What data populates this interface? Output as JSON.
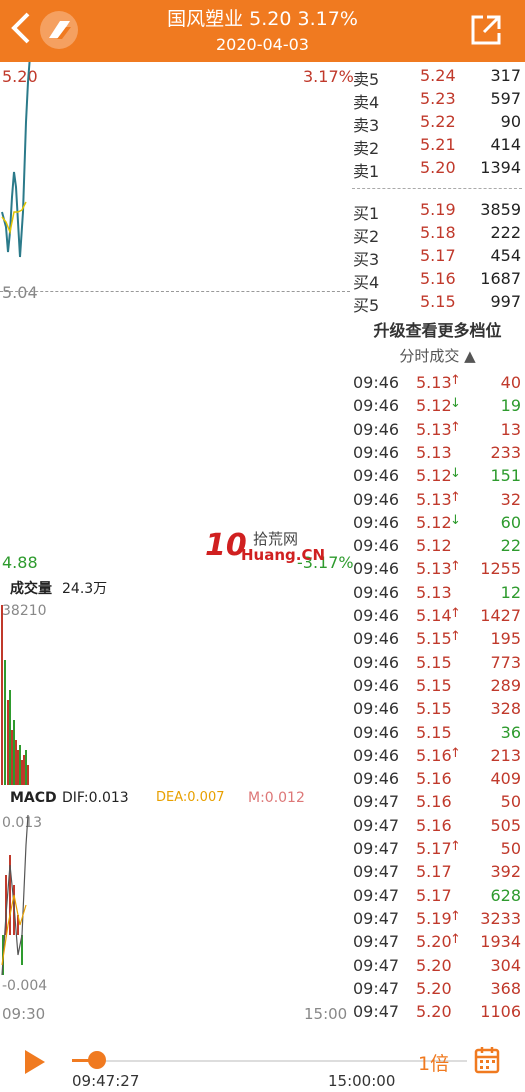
{
  "header": {
    "title": "国风塑业  5.20  3.17%",
    "date": "2020-04-03"
  },
  "price_chart": {
    "high_price": "5.20",
    "high_pct": "3.17%",
    "mid_price": "5.04",
    "low_price": "4.88",
    "low_pct": "-3.17%"
  },
  "volume": {
    "label": "成交量",
    "value": "24.3万",
    "max": "38210"
  },
  "macd": {
    "label": "MACD",
    "dif": "DIF:0.013",
    "dea": "DEA:0.007",
    "m": "M:0.012",
    "top": "0.013",
    "bottom": "-0.004"
  },
  "time_axis": {
    "start": "09:30",
    "end": "15:00"
  },
  "order_book": {
    "asks": [
      {
        "label": "卖5",
        "price": "5.24",
        "vol": "317"
      },
      {
        "label": "卖4",
        "price": "5.23",
        "vol": "597"
      },
      {
        "label": "卖3",
        "price": "5.22",
        "vol": "90"
      },
      {
        "label": "卖2",
        "price": "5.21",
        "vol": "414"
      },
      {
        "label": "卖1",
        "price": "5.20",
        "vol": "1394"
      }
    ],
    "bids": [
      {
        "label": "买1",
        "price": "5.19",
        "vol": "3859"
      },
      {
        "label": "买2",
        "price": "5.18",
        "vol": "222"
      },
      {
        "label": "买3",
        "price": "5.17",
        "vol": "454"
      },
      {
        "label": "买4",
        "price": "5.16",
        "vol": "1687"
      },
      {
        "label": "买5",
        "price": "5.15",
        "vol": "997"
      }
    ]
  },
  "upgrade_label": "升级查看更多档位",
  "ticks_header": "分时成交 ▲",
  "ticks": [
    {
      "time": "09:46",
      "price": "5.13",
      "arrow": "↑",
      "vol": "40",
      "color": "#c0392b",
      "vcolor": "#c0392b"
    },
    {
      "time": "09:46",
      "price": "5.12",
      "arrow": "↓",
      "vol": "19",
      "color": "#c0392b",
      "vcolor": "#2e9b2e"
    },
    {
      "time": "09:46",
      "price": "5.13",
      "arrow": "↑",
      "vol": "13",
      "color": "#c0392b",
      "vcolor": "#c0392b"
    },
    {
      "time": "09:46",
      "price": "5.13",
      "arrow": "",
      "vol": "233",
      "color": "#c0392b",
      "vcolor": "#c0392b"
    },
    {
      "time": "09:46",
      "price": "5.12",
      "arrow": "↓",
      "vol": "151",
      "color": "#c0392b",
      "vcolor": "#2e9b2e"
    },
    {
      "time": "09:46",
      "price": "5.13",
      "arrow": "↑",
      "vol": "32",
      "color": "#c0392b",
      "vcolor": "#c0392b"
    },
    {
      "time": "09:46",
      "price": "5.12",
      "arrow": "↓",
      "vol": "60",
      "color": "#c0392b",
      "vcolor": "#2e9b2e"
    },
    {
      "time": "09:46",
      "price": "5.12",
      "arrow": "",
      "vol": "22",
      "color": "#c0392b",
      "vcolor": "#2e9b2e"
    },
    {
      "time": "09:46",
      "price": "5.13",
      "arrow": "↑",
      "vol": "1255",
      "color": "#c0392b",
      "vcolor": "#c0392b"
    },
    {
      "time": "09:46",
      "price": "5.13",
      "arrow": "",
      "vol": "12",
      "color": "#c0392b",
      "vcolor": "#2e9b2e"
    },
    {
      "time": "09:46",
      "price": "5.14",
      "arrow": "↑",
      "vol": "1427",
      "color": "#c0392b",
      "vcolor": "#c0392b"
    },
    {
      "time": "09:46",
      "price": "5.15",
      "arrow": "↑",
      "vol": "195",
      "color": "#c0392b",
      "vcolor": "#c0392b"
    },
    {
      "time": "09:46",
      "price": "5.15",
      "arrow": "",
      "vol": "773",
      "color": "#c0392b",
      "vcolor": "#c0392b"
    },
    {
      "time": "09:46",
      "price": "5.15",
      "arrow": "",
      "vol": "289",
      "color": "#c0392b",
      "vcolor": "#c0392b"
    },
    {
      "time": "09:46",
      "price": "5.15",
      "arrow": "",
      "vol": "328",
      "color": "#c0392b",
      "vcolor": "#c0392b"
    },
    {
      "time": "09:46",
      "price": "5.15",
      "arrow": "",
      "vol": "36",
      "color": "#c0392b",
      "vcolor": "#2e9b2e"
    },
    {
      "time": "09:46",
      "price": "5.16",
      "arrow": "↑",
      "vol": "213",
      "color": "#c0392b",
      "vcolor": "#c0392b"
    },
    {
      "time": "09:46",
      "price": "5.16",
      "arrow": "",
      "vol": "409",
      "color": "#c0392b",
      "vcolor": "#c0392b"
    },
    {
      "time": "09:47",
      "price": "5.16",
      "arrow": "",
      "vol": "50",
      "color": "#c0392b",
      "vcolor": "#c0392b"
    },
    {
      "time": "09:47",
      "price": "5.16",
      "arrow": "",
      "vol": "505",
      "color": "#c0392b",
      "vcolor": "#c0392b"
    },
    {
      "time": "09:47",
      "price": "5.17",
      "arrow": "↑",
      "vol": "50",
      "color": "#c0392b",
      "vcolor": "#c0392b"
    },
    {
      "time": "09:47",
      "price": "5.17",
      "arrow": "",
      "vol": "392",
      "color": "#c0392b",
      "vcolor": "#c0392b"
    },
    {
      "time": "09:47",
      "price": "5.17",
      "arrow": "",
      "vol": "628",
      "color": "#c0392b",
      "vcolor": "#2e9b2e"
    },
    {
      "time": "09:47",
      "price": "5.19",
      "arrow": "↑",
      "vol": "3233",
      "color": "#c0392b",
      "vcolor": "#c0392b"
    },
    {
      "time": "09:47",
      "price": "5.20",
      "arrow": "↑",
      "vol": "1934",
      "color": "#c0392b",
      "vcolor": "#c0392b"
    },
    {
      "time": "09:47",
      "price": "5.20",
      "arrow": "",
      "vol": "304",
      "color": "#c0392b",
      "vcolor": "#c0392b"
    },
    {
      "time": "09:47",
      "price": "5.20",
      "arrow": "",
      "vol": "368",
      "color": "#c0392b",
      "vcolor": "#c0392b"
    },
    {
      "time": "09:47",
      "price": "5.20",
      "arrow": "",
      "vol": "1106",
      "color": "#c0392b",
      "vcolor": "#c0392b"
    }
  ],
  "playback": {
    "current_time": "09:47:27",
    "end_time": "15:00:00",
    "speed": "1倍",
    "progress": 0.0
  },
  "watermark": {
    "brand": "拾荒网",
    "domain": "Huang.CN",
    "number": "10"
  },
  "colors": {
    "accent": "#f07a20",
    "up": "#c0392b",
    "down": "#2e9b2e"
  }
}
